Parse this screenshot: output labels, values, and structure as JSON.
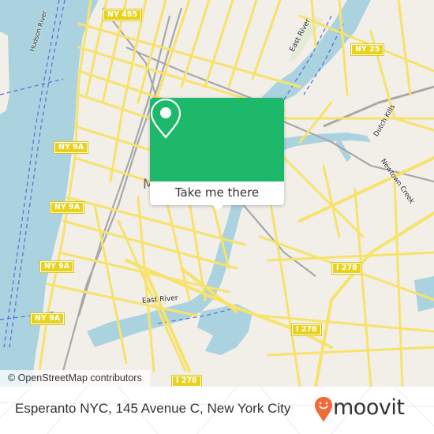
{
  "map": {
    "shields": [
      {
        "id": "ny495",
        "label": "NY 495"
      },
      {
        "id": "ny25",
        "label": "NY 25"
      },
      {
        "id": "ny9a-1",
        "label": "NY 9A"
      },
      {
        "id": "ny9a-2",
        "label": "NY 9A"
      },
      {
        "id": "ny9a-3",
        "label": "NY 9A"
      },
      {
        "id": "ny9a-4",
        "label": "NY 9A"
      },
      {
        "id": "i278-1",
        "label": "I 278"
      },
      {
        "id": "i278-2",
        "label": "I 278"
      },
      {
        "id": "i278-3",
        "label": "I 278"
      }
    ],
    "labels": {
      "east_river_north": "East River",
      "east_river_south": "East River",
      "hudson_river": "Hudson River",
      "newtown_creek": "Newtown Creek",
      "dutch_kills": "Dutch Kills",
      "partial_m": "M"
    },
    "attribution": "© OpenStreetMap contributors",
    "colors": {
      "water": "#aad3df",
      "land": "#f2efe9",
      "road": "#f7e26b",
      "shield": "#e8d21d",
      "rail": "#999999",
      "ferry": "#5c6fe0"
    }
  },
  "popup": {
    "icon": "location-pin-icon",
    "button_label": "Take me there",
    "color": "#1db869"
  },
  "footer": {
    "address": "Esperanto NYC, 145 Avenue C, New York City",
    "logo_text": "moovit",
    "logo_color": "#f26a37"
  }
}
